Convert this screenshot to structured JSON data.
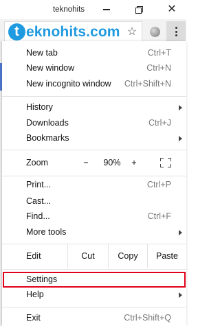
{
  "window": {
    "title": "teknohits"
  },
  "omnibox": {
    "logo_letter": "t",
    "logo_text": "eknohits.com",
    "logo_color": "#1f9ae0"
  },
  "menu": {
    "new_tab": {
      "label": "New tab",
      "shortcut": "Ctrl+T"
    },
    "new_window": {
      "label": "New window",
      "shortcut": "Ctrl+N"
    },
    "new_incognito": {
      "label": "New incognito window",
      "shortcut": "Ctrl+Shift+N"
    },
    "history": {
      "label": "History"
    },
    "downloads": {
      "label": "Downloads",
      "shortcut": "Ctrl+J"
    },
    "bookmarks": {
      "label": "Bookmarks"
    },
    "zoom": {
      "label": "Zoom",
      "minus": "−",
      "value": "90%",
      "plus": "+"
    },
    "print": {
      "label": "Print...",
      "shortcut": "Ctrl+P"
    },
    "cast": {
      "label": "Cast..."
    },
    "find": {
      "label": "Find...",
      "shortcut": "Ctrl+F"
    },
    "more_tools": {
      "label": "More tools"
    },
    "edit": {
      "label": "Edit",
      "cut": "Cut",
      "copy": "Copy",
      "paste": "Paste"
    },
    "settings": {
      "label": "Settings",
      "highlight_color": "#e0001b"
    },
    "help": {
      "label": "Help"
    },
    "exit": {
      "label": "Exit",
      "shortcut": "Ctrl+Shift+Q"
    }
  },
  "icons": [
    "minimize-icon",
    "restore-icon",
    "close-icon",
    "star-icon",
    "extension-icon",
    "kebab-menu-icon",
    "chevron-right-icon",
    "fullscreen-icon"
  ]
}
